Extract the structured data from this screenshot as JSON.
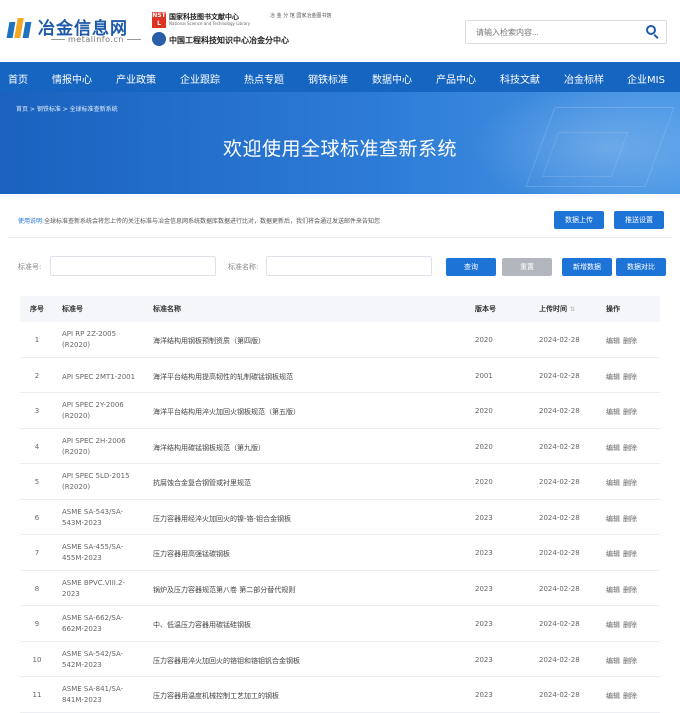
{
  "header": {
    "logo_text": "冶金信息网",
    "logo_sub": "metalinfo.cn",
    "partner_line1": "国家科技图书文献中心",
    "partner_line1_en": "National Science and Technology Library",
    "partner_side": "冶 金 分 馆 国家冶金图书馆",
    "partner_line2": "中国工程科技知识中心冶金分中心",
    "nstl_badge": "NST L",
    "search_placeholder": "请输入检索内容..."
  },
  "nav": [
    "首页",
    "情报中心",
    "产业政策",
    "企业跟踪",
    "热点专题",
    "钢铁标准",
    "数据中心",
    "产品中心",
    "科技文献",
    "冶金标样",
    "企业MIS"
  ],
  "banner": {
    "breadcrumb": "首页 > 钢铁标准 > 全球标准查新系统",
    "title": "欢迎使用全球标准查新系统"
  },
  "notice": {
    "label": "使用说明:",
    "text": "全球标准查新系统会将您上传的关注标准与冶金信息网系统数据库数据进行比对，数据更新后，我们将会通过发送邮件来告知您",
    "upload_label": "数据上传",
    "push_label": "推送设置"
  },
  "filter": {
    "code_label": "标准号:",
    "name_label": "标准名称:",
    "query_label": "查询",
    "reset_label": "重置",
    "add_label": "新增数据",
    "compare_label": "数据对比"
  },
  "table": {
    "headers": {
      "no": "序号",
      "code": "标准号",
      "name": "标准名称",
      "version": "版本号",
      "upload_time": "上传时间",
      "ops": "操作"
    },
    "edit_label": "编辑",
    "delete_label": "删除",
    "rows": [
      {
        "no": "1",
        "code": "API RP 2Z-2005 (R2020)",
        "name": "海洋结构用钢板预制资质（第四版）",
        "version": "2020",
        "date": "2024-02-28"
      },
      {
        "no": "2",
        "code": "API SPEC 2MT1-2001",
        "name": "海洋平台结构用提高韧性的轧制碳锰钢板规范",
        "version": "2001",
        "date": "2024-02-28"
      },
      {
        "no": "3",
        "code": "API SPEC 2Y-2006 (R2020)",
        "name": "海洋平台结构用淬火加回火钢板规范（第五版）",
        "version": "2020",
        "date": "2024-02-28"
      },
      {
        "no": "4",
        "code": "API SPEC 2H-2006 (R2020)",
        "name": "海洋结构用碳锰钢板规范（第九版）",
        "version": "2020",
        "date": "2024-02-28"
      },
      {
        "no": "5",
        "code": "API SPEC 5LD-2015 (R2020)",
        "name": "抗腐蚀合金复合钢管或衬里规范",
        "version": "2020",
        "date": "2024-02-28"
      },
      {
        "no": "6",
        "code": "ASME SA-543/SA-543M-2023",
        "name": "压力容器用经淬火加回火的镍-铬-钼合金钢板",
        "version": "2023",
        "date": "2024-02-28"
      },
      {
        "no": "7",
        "code": "ASME SA-455/SA-455M-2023",
        "name": "压力容器用高强锰碳钢板",
        "version": "2023",
        "date": "2024-02-28"
      },
      {
        "no": "8",
        "code": "ASME BPVC.VIII.2-2023",
        "name": "锅炉及压力容器规范第八卷 第二部分替代规则",
        "version": "2023",
        "date": "2024-02-28"
      },
      {
        "no": "9",
        "code": "ASME SA-662/SA-662M-2023",
        "name": "中、低温压力容器用碳锰硅钢板",
        "version": "2023",
        "date": "2024-02-28"
      },
      {
        "no": "10",
        "code": "ASME SA-542/SA-542M-2023",
        "name": "压力容器用淬火加回火的铬钼和铬钼钒合金钢板",
        "version": "2023",
        "date": "2024-02-28"
      },
      {
        "no": "11",
        "code": "ASME SA-841/SA-841M-2023",
        "name": "压力容器用温度机械控制工艺加工的钢板",
        "version": "2023",
        "date": "2024-02-28"
      }
    ]
  }
}
